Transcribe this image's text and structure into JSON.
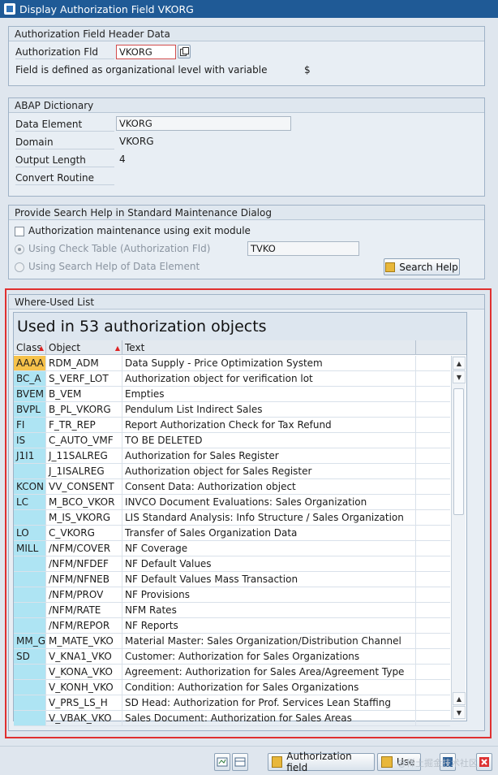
{
  "window": {
    "title": "Display Authorization Field VKORG"
  },
  "header_group": {
    "title": "Authorization Field Header Data",
    "auth_field_label": "Authorization Fld",
    "auth_field_value": "VKORG",
    "org_level_text": "Field is defined as organizational level with variable",
    "org_level_value": "$"
  },
  "abap_group": {
    "title": "ABAP Dictionary",
    "data_element_label": "Data Element",
    "data_element_value": "VKORG",
    "domain_label": "Domain",
    "domain_value": "VKORG",
    "output_length_label": "Output Length",
    "output_length_value": "4",
    "convert_routine_label": "Convert Routine"
  },
  "search_group": {
    "title": "Provide Search Help in Standard Maintenance Dialog",
    "exit_module_label": "Authorization maintenance using exit module",
    "check_table_label": "Using Check Table (Authorization Fld)",
    "check_table_value": "TVKO",
    "search_help_label": "Using Search Help of Data Element",
    "search_help_button": "Search Help"
  },
  "where_used": {
    "title": "Where-Used List",
    "header": "Used in 53 authorization objects",
    "columns": [
      "Class",
      "Object",
      "Text"
    ],
    "rows": [
      {
        "cls": "AAAA",
        "obj": "RDM_ADM",
        "text": "Data Supply - Price Optimization System"
      },
      {
        "cls": "BC_A",
        "obj": "S_VERF_LOT",
        "text": "Authorization object for verification lot"
      },
      {
        "cls": "BVEM",
        "obj": "B_VEM",
        "text": "Empties"
      },
      {
        "cls": "BVPL",
        "obj": "B_PL_VKORG",
        "text": "Pendulum List Indirect Sales"
      },
      {
        "cls": "FI",
        "obj": "F_TR_REP",
        "text": "Report Authorization Check for Tax Refund"
      },
      {
        "cls": "IS",
        "obj": "C_AUTO_VMF",
        "text": "TO BE DELETED"
      },
      {
        "cls": "J1I1",
        "obj": "J_11SALREG",
        "text": "Authorization for Sales Register"
      },
      {
        "cls": "",
        "obj": "J_1ISALREG",
        "text": "Authorization object for Sales Register"
      },
      {
        "cls": "KCON",
        "obj": "VV_CONSENT",
        "text": "Consent Data: Authorization object"
      },
      {
        "cls": "LC",
        "obj": "M_BCO_VKOR",
        "text": "INVCO Document Evaluations: Sales Organization"
      },
      {
        "cls": "",
        "obj": "M_IS_VKORG",
        "text": "LIS Standard Analysis: Info Structure / Sales Organization"
      },
      {
        "cls": "LO",
        "obj": "C_VKORG",
        "text": "Transfer of Sales Organization Data"
      },
      {
        "cls": "MILL",
        "obj": "/NFM/COVER",
        "text": "NF Coverage"
      },
      {
        "cls": "",
        "obj": "/NFM/NFDEF",
        "text": "NF Default Values"
      },
      {
        "cls": "",
        "obj": "/NFM/NFNEB",
        "text": "NF Default Values Mass Transaction"
      },
      {
        "cls": "",
        "obj": "/NFM/PROV",
        "text": "NF Provisions"
      },
      {
        "cls": "",
        "obj": "/NFM/RATE",
        "text": "NFM Rates"
      },
      {
        "cls": "",
        "obj": "/NFM/REPOR",
        "text": "NF Reports"
      },
      {
        "cls": "MM_G",
        "obj": "M_MATE_VKO",
        "text": "Material Master: Sales Organization/Distribution Channel"
      },
      {
        "cls": "SD",
        "obj": "V_KNA1_VKO",
        "text": "Customer: Authorization for Sales Organizations"
      },
      {
        "cls": "",
        "obj": "V_KONA_VKO",
        "text": "Agreement: Authorization for Sales Area/Agreement Type"
      },
      {
        "cls": "",
        "obj": "V_KONH_VKO",
        "text": "Condition: Authorization for Sales Organizations"
      },
      {
        "cls": "",
        "obj": "V_PRS_LS_H",
        "text": "SD Head: Authorization for Prof. Services Lean Staffing"
      },
      {
        "cls": "",
        "obj": "V_VBAK_VKO",
        "text": "Sales Document: Authorization for Sales Areas"
      }
    ]
  },
  "footer": {
    "auth_field_button": "Authorization field",
    "use_button": "Use",
    "watermark": "@稀土掘金技术社区"
  },
  "colors": {
    "title_bar": "#1f5a96",
    "class_cell": "#aee4f3",
    "highlight_cell": "#f6c24b",
    "frame_red": "#e03030"
  }
}
